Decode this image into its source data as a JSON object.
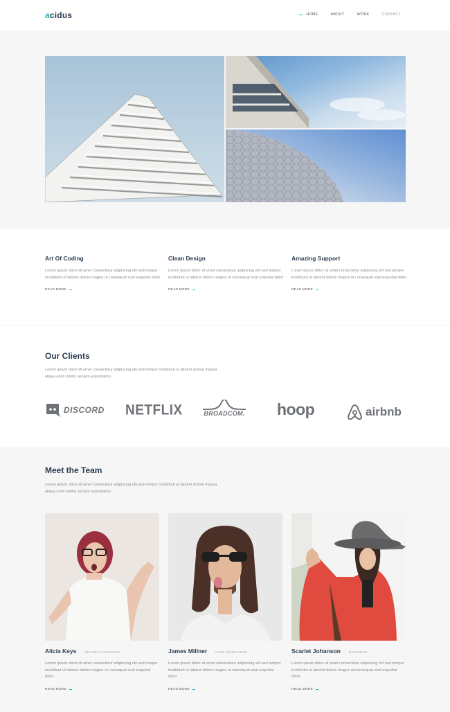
{
  "header": {
    "logo_accent": "a",
    "logo_rest": "cidus",
    "nav": [
      "HOME",
      "ABOUT",
      "WORK",
      "CONTACT"
    ]
  },
  "features": [
    {
      "title": "Art Of Coding",
      "text": "Lorem ipsum dolor sit amet consectetur adipiscing elit sed tempor incididunt ut laboret dolore magna ut consequat siad esqudiat dolor",
      "link": "READ MORE"
    },
    {
      "title": "Clean Design",
      "text": "Lorem ipsum dolor sit amet consectetur adipiscing elit sed tempor incididunt ut laboret dolore magna ut consequat siad esqudiat dolor",
      "link": "READ MORE"
    },
    {
      "title": "Amazing Support",
      "text": "Lorem ipsum dolor sit amet consectetur adipiscing elit sed tempor incididunt ut laboret dolore magna ut consequat siad esqudiat dolor",
      "link": "READ MORE"
    }
  ],
  "clients": {
    "title": "Our Clients",
    "text": "Lorem ipsum dolor sit amet consectetur adipiscing elit sed tempor incididunt ut laboret dolore magna aliqua enim minim veniam exercitation",
    "logos": [
      "DISCORD",
      "NETFLIX",
      "BROADCOM.",
      "hoop",
      "airbnb"
    ]
  },
  "team": {
    "title": "Meet the Team",
    "text": "Lorem ipsum dolor sit amet consectetur adipiscing elit sed tempor incididunt ut laboret dolore magna aliqua enim minim veniam exercitation",
    "members": [
      {
        "name": "Alicia Keys",
        "role": "PROJECT MANAGER",
        "text": "Lorem ipsum dolor sit amet consectetur adipiscing elit sed tempor incididunt ut laboret dolore magna ut consequat siad esqudiat dolor",
        "link": "READ MORE"
      },
      {
        "name": "James Millner",
        "role": "LEAD DEVELOPER",
        "text": "Lorem ipsum dolor sit amet consectetur adipiscing elit sed tempor incididunt ut laboret dolore magna ut consequat siad esqudiat dolor",
        "link": "READ MORE"
      },
      {
        "name": "Scarlet Johanson",
        "role": "DESIGNER",
        "text": "Lorem ipsum dolor sit amet consectetur adipiscing elit sed tempor incididunt ut laboret dolore magna ut consequat siad esqudiat dolor",
        "link": "READ MORE"
      }
    ]
  },
  "colors": {
    "accent": "#1fb6c9",
    "heading": "#2c3e50",
    "body_text": "#8a8a8a"
  }
}
